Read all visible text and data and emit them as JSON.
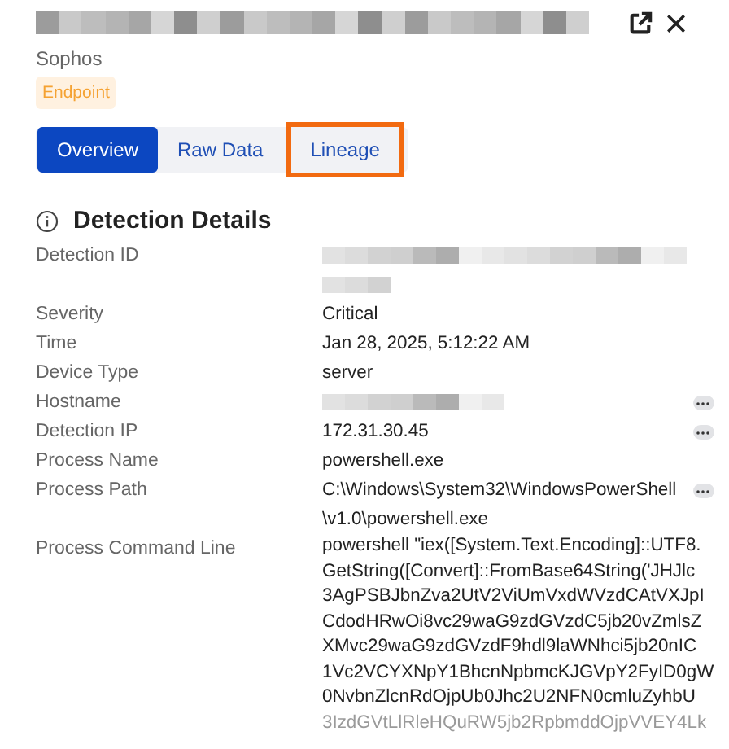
{
  "header": {
    "title": {
      "kind": "redacted"
    },
    "source": "Sophos",
    "badge": "Endpoint"
  },
  "tabs": [
    {
      "label": "Overview",
      "selected": true,
      "highlighted": false
    },
    {
      "label": "Raw Data",
      "selected": false,
      "highlighted": false
    },
    {
      "label": "Lineage",
      "selected": false,
      "highlighted": true
    }
  ],
  "section": {
    "title": "Detection Details"
  },
  "fields": [
    {
      "label": "Detection ID",
      "kind": "redacted",
      "more": false,
      "lines": [
        {
          "kind": "long"
        },
        {
          "kind": "short"
        }
      ]
    },
    {
      "label": "Severity",
      "kind": "text",
      "more": false,
      "lines": [
        "Critical"
      ]
    },
    {
      "label": "Time",
      "kind": "text",
      "more": false,
      "lines": [
        "Jan 28, 2025, 5:12:22 AM"
      ]
    },
    {
      "label": "Device Type",
      "kind": "text",
      "more": false,
      "lines": [
        "server"
      ]
    },
    {
      "label": "Hostname",
      "kind": "redacted",
      "more": true,
      "lines": [
        {
          "kind": "medium"
        }
      ]
    },
    {
      "label": "Detection IP",
      "kind": "text",
      "more": true,
      "lines": [
        "172.31.30.45"
      ]
    },
    {
      "label": "Process Name",
      "kind": "text",
      "more": false,
      "lines": [
        "powershell.exe"
      ]
    },
    {
      "label": "Process Path",
      "kind": "text",
      "more": true,
      "lines": [
        "C:\\Windows\\System32\\WindowsPowerShell",
        "\\v1.0\\powershell.exe"
      ]
    },
    {
      "label": "Process Command Line",
      "kind": "text",
      "more": false,
      "lines": [
        "powershell \"iex([System.Text.Encoding]::UTF8.",
        "GetString([Convert]::FromBase64String('JHJlc",
        "3AgPSBJbnZva2UtV2ViUmVxdWVzdCAtVXJpI",
        "CdodHRwOi8vc29waG9zdGVzdC5jb20vZmlsZ",
        "XMvc29waG9zdGVzdF9hdl9laWNhci5jb20nIC",
        "1Vc2VCYXNpY1BhcnNpbmcKJGVpY2FyID0gW",
        "0NvbnZlcnRdOjpUb0Jhc2U2NFN0cmluZyhbU",
        "3IzdGVtLlRleHQuRW5jb2RpbmddOjpVVEY4Lk"
      ]
    }
  ]
}
